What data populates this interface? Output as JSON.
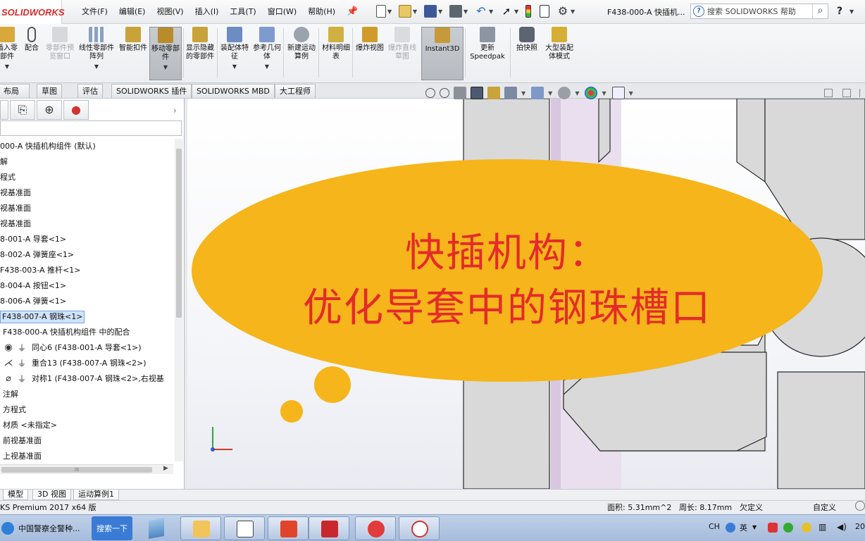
{
  "app": {
    "logo_text": "SOLIDWORKS",
    "menu": [
      "文件(F)",
      "编辑(E)",
      "视图(V)",
      "插入(I)",
      "工具(T)",
      "窗口(W)",
      "帮助(H)"
    ],
    "doc_title": "F438-000-A 快插机...",
    "help_search_placeholder": "搜索 SOLIDWORKS 帮助",
    "help_label": "?"
  },
  "commands": [
    {
      "label": "插入零部件",
      "disabled": false
    },
    {
      "label": "配合",
      "disabled": false
    },
    {
      "label": "零部件预览窗口",
      "disabled": true
    },
    {
      "label": "线性零部件阵列",
      "disabled": false
    },
    {
      "label": "智能扣件",
      "disabled": false
    },
    {
      "label": "移动零部件",
      "disabled": false,
      "active": true
    },
    {
      "label": "显示隐藏的零部件",
      "disabled": false
    },
    {
      "label": "装配体特征",
      "disabled": false
    },
    {
      "label": "参考几何体",
      "disabled": false
    },
    {
      "label": "新建运动算例",
      "disabled": false
    },
    {
      "label": "材料明细表",
      "disabled": false
    },
    {
      "label": "爆炸视图",
      "disabled": false
    },
    {
      "label": "爆炸直线草图",
      "disabled": true
    },
    {
      "label": "Instant3D",
      "disabled": false,
      "active": true
    },
    {
      "label": "更新Speedpak",
      "disabled": false
    },
    {
      "label": "拍快照",
      "disabled": false
    },
    {
      "label": "大型装配体模式",
      "disabled": false
    }
  ],
  "tabs": [
    "布局",
    "草图",
    "评估",
    "SOLIDWORKS 插件",
    "SOLIDWORKS MBD",
    "大工程师"
  ],
  "tree": {
    "items": [
      "000-A 快插机构组件 (默认)",
      "解",
      "程式",
      "视基准面",
      "视基准面",
      "视基准面",
      "8-001-A 导套<1>",
      "8-002-A 弹簧座<1>",
      "F438-003-A 推杆<1>",
      "8-004-A 按钮<1>",
      "8-006-A 弹簧<1>",
      "F438-007-A 钢珠<1>",
      "F438-000-A 快插机构组件 中的配合",
      "同心6 (F438-001-A 导套<1>)",
      "重合13 (F438-007-A 钢珠<2>)",
      "对称1 (F438-007-A 钢珠<2>,右视基",
      "注解",
      "方程式",
      "材质 <未指定>",
      "前视基准面",
      "上视基准面"
    ],
    "selected_index": 11
  },
  "overlay": {
    "line1": "快插机构：",
    "line2": "优化导套中的钢珠槽口",
    "color_bg": "#f5b51b",
    "color_text": "#e52a2a"
  },
  "bottom_tabs": [
    "模型",
    "3D 视图",
    "运动算例1"
  ],
  "status": {
    "product": "KS Premium 2017 x64 版",
    "area": "面积: 5.31mm^2",
    "perimeter": "周长: 8.17mm",
    "state": "欠定义",
    "custom": "自定义"
  },
  "taskbar": {
    "ie_label": "中国警察全警种...",
    "search_label": "搜索一下",
    "tray_lang": "CH",
    "tray_ime": "英",
    "clock": "20"
  },
  "colors": {
    "accent_blue": "#2c6fcf",
    "part_gray": "#d9d9d9",
    "selection": "#cfe3fb"
  }
}
